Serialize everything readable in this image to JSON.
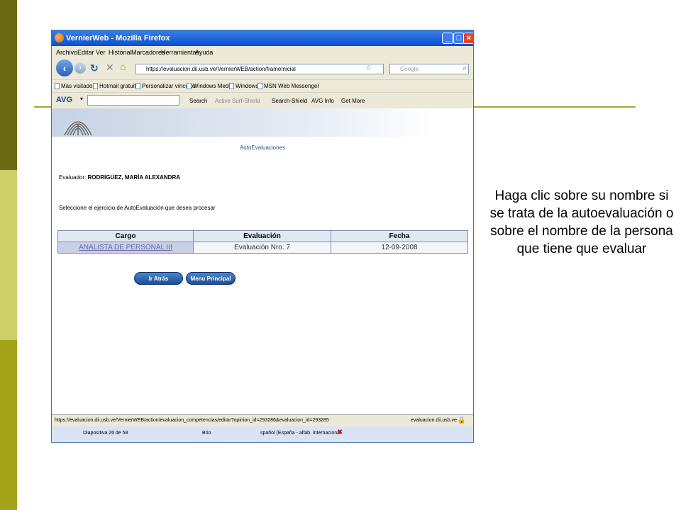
{
  "slide": {
    "caption": "Haga clic sobre su nombre si se trata de la autoevaluación o sobre el nombre de la persona que tiene que evaluar"
  },
  "browser": {
    "title": "VernierWeb - Mozilla Firefox",
    "menu": [
      "Archivo",
      "Editar",
      "Ver",
      "Historial",
      "Marcadores",
      "Herramientas",
      "Ayuda"
    ],
    "url": "https://evaluacion.dii.usb.ve/VernierWEB/action/frameInicial",
    "search_placeholder": "Google",
    "bookmarks": [
      "Más visitados",
      "Hotmail gratuito",
      "Personalizar vínculos",
      "Windows Media",
      "Windows",
      "MSN Web Messenger"
    ],
    "avg": {
      "logo": "AVG",
      "search": "Search",
      "active_surf_shield": "Active Surf-Shield",
      "search_shield": "Search-Shield",
      "avg_info": "AVG Info",
      "get_more": "Get More"
    },
    "status_url": "https://evaluacion.dii.usb.ve/VernierWEB/action/evaluacion_competencias/editar?opinion_id=293286&evaluacion_id=293285",
    "status_domain": "evaluacion.dii.usb.ve"
  },
  "page": {
    "heading": "AutoEvaluaciones",
    "evaluator_label": "Evaluador:",
    "evaluator_name": "RODRIGUEZ, MARÍA ALEXANDRA",
    "instruction": "Seleccione el ejercicio de AutoEvaluación que desea procesar",
    "table": {
      "headers": [
        "Cargo",
        "Evaluación",
        "Fecha"
      ],
      "row": [
        "ANALISTA DE PERSONAL III",
        "Evaluación Nro. 7",
        "12-09-2008"
      ]
    },
    "buttons": {
      "back": "Ir Atrás",
      "menu": "Menu Principal"
    }
  },
  "ppt_status": {
    "slide_num": "Diapositiva 26 de 58",
    "theme": "Brio",
    "language": "spañol (España - alfab. internacional"
  }
}
